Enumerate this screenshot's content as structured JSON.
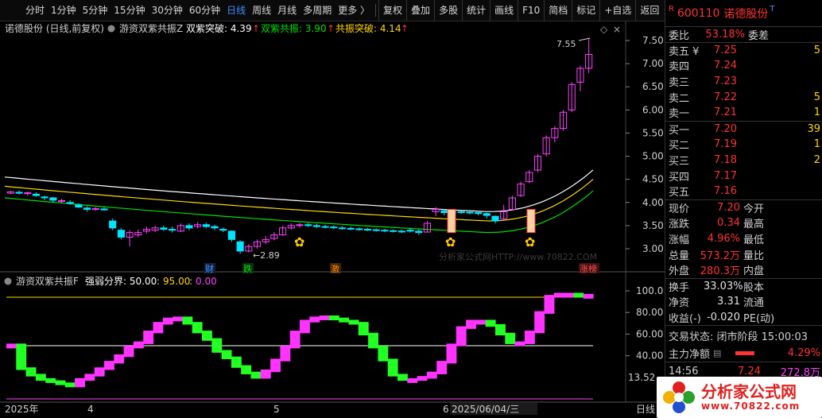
{
  "toolbar": {
    "periods": [
      "分时",
      "1分钟",
      "5分钟",
      "15分钟",
      "30分钟",
      "60分钟",
      "日线",
      "周线",
      "月线",
      "多周期",
      "更多 〉"
    ],
    "active_period": "日线",
    "buttons": [
      "复权",
      "叠加",
      "多股",
      "统计",
      "画线",
      "F10",
      "简档",
      "标记",
      "+自选",
      "返回"
    ]
  },
  "main_chart": {
    "title": "诺德股份 (日线,前复权)",
    "indicator": "游资双紫共振Z",
    "legend": [
      {
        "label": "双紫突破: 4.39",
        "color": "#ffffff",
        "arrow": "↑"
      },
      {
        "label": "双紫共振: 3.90",
        "color": "#00e000",
        "arrow": "↑"
      },
      {
        "label": "共振突破: 4.14",
        "color": "#ffd700",
        "arrow": "↑"
      }
    ],
    "price_axis": [
      "7.50",
      "7.00",
      "6.50",
      "6.00",
      "5.50",
      "5.00",
      "4.50",
      "4.00",
      "3.50",
      "3.00"
    ],
    "high_label": "7.55",
    "low_label": "←2.89",
    "watermark": "分析家公式网HTTP://www.70822.COM",
    "event_tags": [
      {
        "text": "财",
        "color": "#4d8eff"
      },
      {
        "text": "跌",
        "color": "#00e000"
      },
      {
        "text": "激",
        "color": "#ff8800"
      },
      {
        "text": "涨榜",
        "color": "#ff3333"
      }
    ]
  },
  "sub_chart": {
    "title": "游资双紫共振F",
    "line_label": "强弱分界: 50.00",
    "line2": "95.00",
    "line3": "0.00",
    "axis": [
      "100.0",
      "80.00",
      "60.00",
      "40.00"
    ],
    "corner_value": "13.52"
  },
  "time_axis": {
    "labels": [
      "2025年",
      "4",
      "5",
      "6",
      "2025/06/04/三"
    ],
    "period_label": "日线"
  },
  "quote": {
    "code": "600110",
    "name": "诺德股份",
    "weibi": {
      "label": "委比",
      "value": "53.18%",
      "label2": "委差"
    },
    "asks": [
      {
        "label": "卖五 ¥",
        "price": "7.25",
        "vol": "5"
      },
      {
        "label": "卖四",
        "price": "7.24",
        "vol": ""
      },
      {
        "label": "卖三",
        "price": "7.23",
        "vol": ""
      },
      {
        "label": "卖二",
        "price": "7.22",
        "vol": "5"
      },
      {
        "label": "卖一",
        "price": "7.21",
        "vol": "1"
      }
    ],
    "bids": [
      {
        "label": "买一",
        "price": "7.20",
        "vol": "39"
      },
      {
        "label": "买二",
        "price": "7.19",
        "vol": "1"
      },
      {
        "label": "买三",
        "price": "7.18",
        "vol": "2"
      },
      {
        "label": "买四",
        "price": "7.17",
        "vol": ""
      },
      {
        "label": "买五",
        "price": "7.16",
        "vol": ""
      }
    ],
    "stats": [
      {
        "l1": "现价",
        "v1": "7.20",
        "l2": "今开",
        "c1": "red"
      },
      {
        "l1": "涨跌",
        "v1": "0.34",
        "l2": "最高",
        "c1": "red"
      },
      {
        "l1": "涨幅",
        "v1": "4.96%",
        "l2": "最低",
        "c1": "red"
      },
      {
        "l1": "总量",
        "v1": "573.2万",
        "l2": "量比",
        "c1": "red"
      },
      {
        "l1": "外盘",
        "v1": "280.3万",
        "l2": "内盘",
        "c1": "red"
      }
    ],
    "stats2": [
      {
        "l1": "换手",
        "v1": "33.03%",
        "l2": "股本"
      },
      {
        "l1": "净资",
        "v1": "3.31",
        "l2": "流通"
      },
      {
        "l1": "收益(-)",
        "v1": "-0.020",
        "l2": "PE(动)"
      }
    ],
    "status": "交易状态: 闭市阶段 15:00:03",
    "main_force": {
      "label": "主力净额",
      "value": "4.29%"
    },
    "last_trade": {
      "time": "14:56",
      "price": "7.24",
      "vol": "272.8万"
    }
  },
  "logo": {
    "text": "分析家公式网",
    "url": "www.70822.com"
  }
}
